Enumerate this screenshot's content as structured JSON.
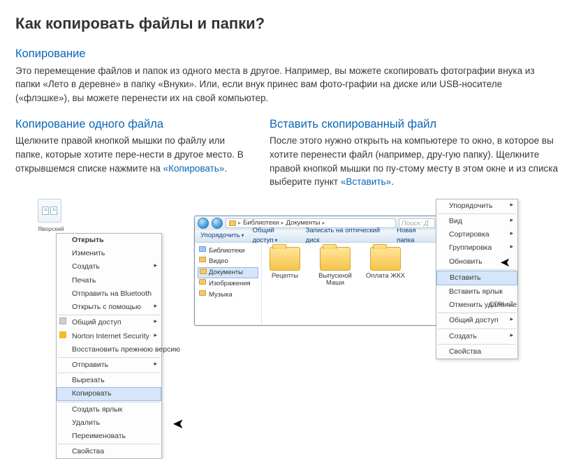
{
  "title": "Как копировать файлы и папки?",
  "section_copy": {
    "heading": "Копирование",
    "text": "Это перемещение файлов и папок из одного места в другое. Например, вы можете скопировать фотографии внука из папки «Лето в деревне» в папку «Внуки». Или, если внук принес вам фото-графии на диске или USB-носителе («флэшке»), вы можете перенести их на свой компьютер."
  },
  "section_one": {
    "heading": "Копирование одного файла",
    "text_before": "Щелкните правой кнопкой мышки по файлу или папке, которые хотите пере-нести в другое место. В открывшемся списке нажмите на ",
    "link": "«Копировать»",
    "period": "."
  },
  "section_paste": {
    "heading": "Вставить скопированный файл",
    "text_before": "После этого нужно открыть на компьютере то окно, в которое вы хотите перенести файл (например, дру-гую папку). Щелкните правой кнопкой мышки по пу-стому месту в этом окне и из списка выберите пункт ",
    "link": "«Вставить»",
    "period": "."
  },
  "file_caption": "Яворский",
  "ctx_left": {
    "open": "Открыть",
    "edit": "Изменить",
    "create": "Создать",
    "print": "Печать",
    "bt": "Отправить на Bluetooth",
    "openwith": "Открыть с помощью",
    "share": "Общий доступ",
    "norton": "Norton Internet Security",
    "restore": "Восстановить прежнюю версию",
    "send": "Отправить",
    "cut": "Вырезать",
    "copy": "Копировать",
    "shortcut": "Создать ярлык",
    "delete": "Удалить",
    "rename": "Переименовать",
    "props": "Свойства"
  },
  "explorer": {
    "crumb1": "Библиотеки",
    "crumb2": "Документы",
    "search": "Поиск: Д",
    "toolbar": {
      "organize": "Упорядочить",
      "share": "Общий доступ",
      "burn": "Записать на оптический диск",
      "newfolder": "Новая папка"
    },
    "tree": {
      "libs": "Библиотеки",
      "video": "Видео",
      "docs": "Документы",
      "images": "Изображения",
      "music": "Музыка"
    },
    "folders": {
      "f1": "Рецепты",
      "f2": "Выпускной Маши",
      "f3": "Оплата ЖКХ"
    }
  },
  "ctx_right": {
    "organize": "Упорядочить",
    "view": "Вид",
    "sort": "Сортировка",
    "group": "Группировка",
    "refresh": "Обновить",
    "paste": "Вставить",
    "paste_shortcut": "Вставить ярлык",
    "undo": "Отменить удаление",
    "undo_key": "CTRL+Z",
    "share": "Общий доступ",
    "create": "Создать",
    "props": "Свойства"
  }
}
